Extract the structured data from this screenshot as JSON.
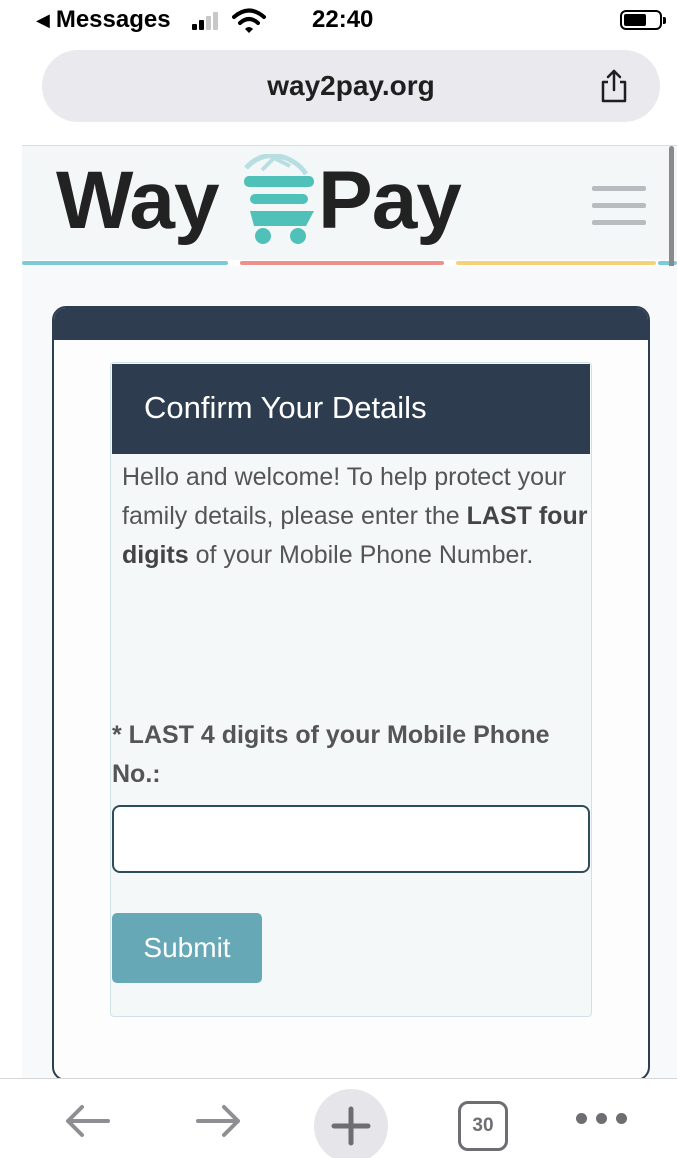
{
  "status_bar": {
    "back_app": "Messages",
    "time": "22:40"
  },
  "browser": {
    "url": "way2pay.org",
    "open_tab_count": "30"
  },
  "site": {
    "logo_left": "Way",
    "logo_right": "Pay"
  },
  "form": {
    "title": "Confirm Your Details",
    "intro_before": "Hello and welcome! To help protect your family details, please enter the ",
    "intro_bold": "LAST four digits",
    "intro_after": " of your Mobile Phone Number.",
    "field_label": "* LAST 4 digits of your Mobile Phone No.:",
    "field_value": "",
    "submit_label": "Submit"
  },
  "colors": {
    "header_dark": "#2d3c4e",
    "button_teal": "#66a8b6",
    "logo_teal": "#4fc1b8",
    "line_blue": "#7ccad8",
    "line_red": "#ee8f8a",
    "line_yellow": "#f3d27a"
  },
  "icons": {
    "back": "back-arrow-icon",
    "forward": "forward-arrow-icon",
    "new_tab": "plus-icon",
    "more": "more-dots-icon",
    "share": "share-icon",
    "menu": "hamburger-menu-icon",
    "cart": "shopping-cart-icon"
  }
}
